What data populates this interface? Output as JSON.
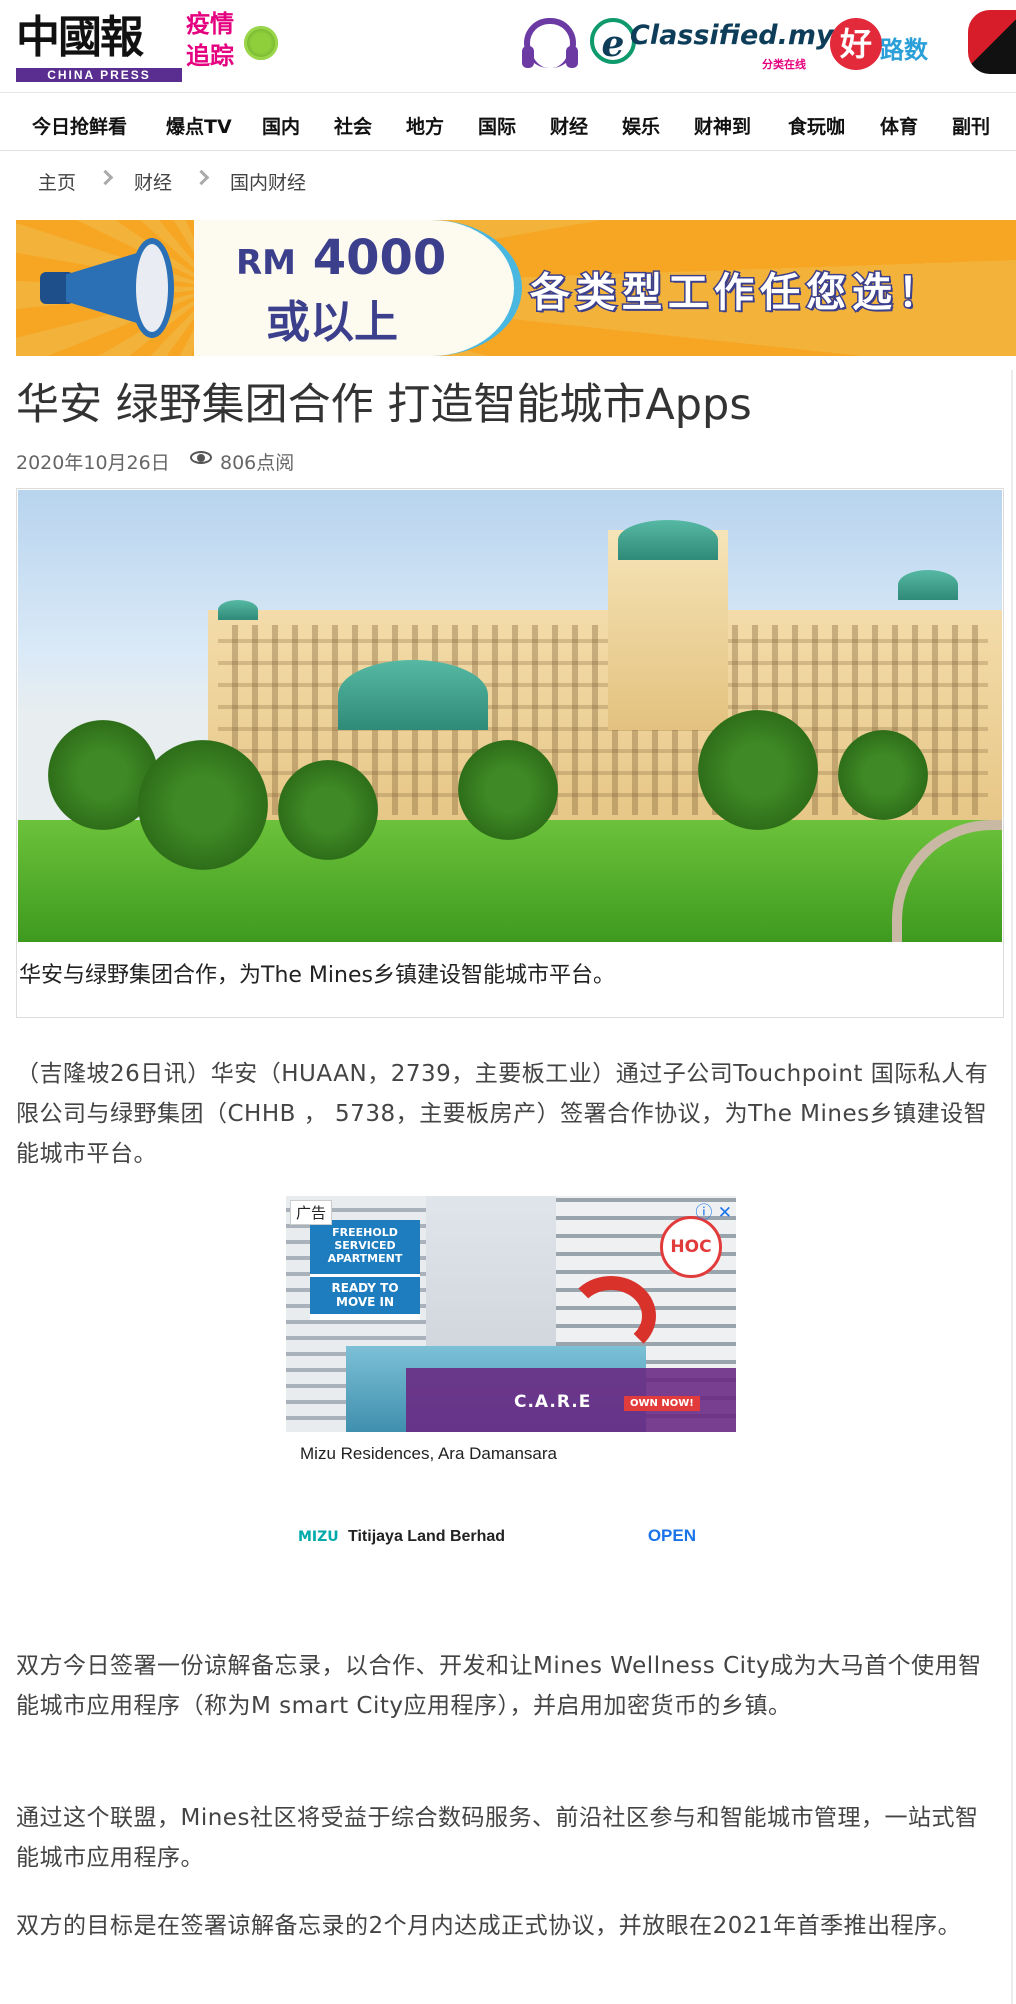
{
  "header": {
    "logo_cn": "中國報",
    "logo_en": "CHINA PRESS",
    "covid_line1": "疫情",
    "covid_line2": "追踪",
    "eclassified_name": "Classified.my",
    "eclassified_sub": "分类在线",
    "hao_char": "好",
    "hao_text": "路数"
  },
  "nav": {
    "items": [
      "今日抢鲜看",
      "爆点TV",
      "国内",
      "社会",
      "地方",
      "国际",
      "财经",
      "娱乐",
      "财神到",
      "食玩咖",
      "体育",
      "副刊"
    ]
  },
  "breadcrumb": [
    "主页",
    "财经",
    "国内财经"
  ],
  "banner": {
    "amount_prefix": "RM",
    "amount": "4000",
    "amount_line2": "或以上",
    "slogan": "各类型工作任您选！"
  },
  "article": {
    "title": "华安 绿野集团合作 打造智能城市Apps",
    "date": "2020年10月26日",
    "views": "806点阅",
    "caption": "华安与绿野集团合作，为The Mines乡镇建设智能城市平台。",
    "paragraphs": [
      "（吉隆坡26日讯）华安（HUAAN，2739，主要板工业）通过子公司Touchpoint 国际私人有限公司与绿野集团（CHHB ， 5738，主要板房产）签署合作协议，为The Mines乡镇建设智能城市平台。",
      "双方今日签署一份谅解备忘录，以合作、开发和让Mines Wellness City成为大马首个使用智能城市应用程序（称为M smart City应用程序），并启用加密货币的乡镇。",
      "通过这个联盟，Mines社区将受益于综合数码服务、前沿社区参与和智能城市管理，一站式智能城市应用程序。",
      "双方的目标是在签署谅解备忘录的2个月内达成正式协议，并放眼在2021年首季推出程序。"
    ]
  },
  "ad": {
    "label": "广告",
    "choices": "ⓘ ✕",
    "ribbon_top": "FREEHOLD\nSERVICED\nAPARTMENT",
    "ribbon_bottom": "READY TO\nMOVE IN",
    "hoc": "HOC",
    "care": "C.A.R.E",
    "own": "OWN NOW!",
    "title": "Mizu Residences, Ara Damansara",
    "brand_logo": "MIZU",
    "brand": "Titijaya Land Berhad",
    "cta": "OPEN"
  }
}
